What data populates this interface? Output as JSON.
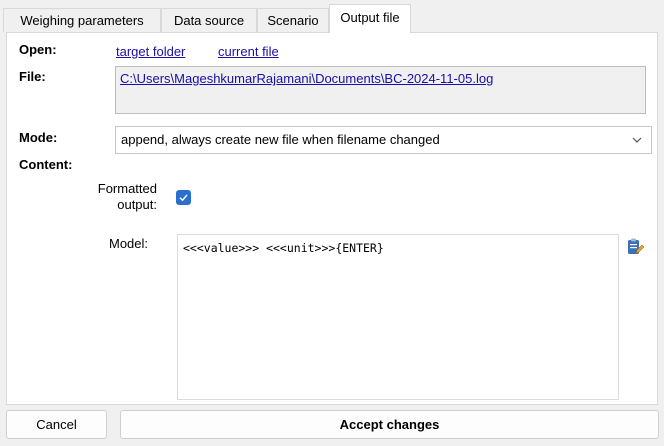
{
  "tabs": [
    "Weighing parameters",
    "Data source",
    "Scenario",
    "Output file"
  ],
  "active_tab": "Output file",
  "open": {
    "label": "Open:",
    "links": [
      "target folder",
      "current file"
    ]
  },
  "file": {
    "label": "File:",
    "path": "C:\\Users\\MageshkumarRajamani\\Documents\\BC-2024-11-05.log"
  },
  "mode": {
    "label": "Mode:",
    "selected": "append, always create new file when filename changed"
  },
  "content": {
    "label": "Content:",
    "formatted_label_line1": "Formatted",
    "formatted_label_line2": "output:",
    "formatted_checked": true,
    "model_label": "Model:",
    "model_value": "<<<value>>> <<<unit>>>{ENTER}"
  },
  "buttons": {
    "cancel": "Cancel",
    "accept": "Accept changes"
  },
  "colors": {
    "accent": "#2a6fcf",
    "link": "#1a0dab"
  }
}
